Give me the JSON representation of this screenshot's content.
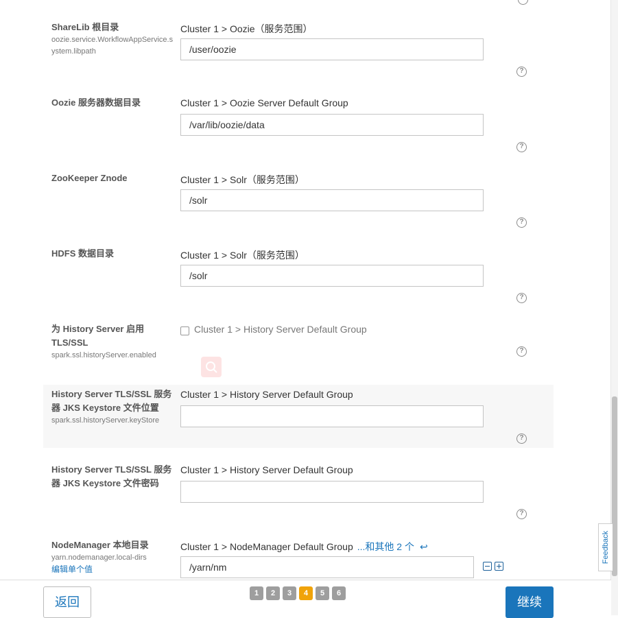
{
  "rows": [
    {
      "title": "ShareLib 根目录",
      "key": "oozie.service.WorkflowAppService.system.libpath",
      "scope": "Cluster 1 > Oozie（服务范围）",
      "value": "/user/oozie"
    },
    {
      "title": "Oozie 服务器数据目录",
      "scope": "Cluster 1 > Oozie Server Default Group",
      "value": "/var/lib/oozie/data"
    },
    {
      "title": "ZooKeeper Znode",
      "scope": "Cluster 1 > Solr（服务范围）",
      "value": "/solr"
    },
    {
      "title": "HDFS 数据目录",
      "scope": "Cluster 1 > Solr（服务范围）",
      "value": "/solr"
    },
    {
      "title": "为 History Server 启用 TLS/SSL",
      "key": "spark.ssl.historyServer.enabled",
      "scope": "Cluster 1 > History Server Default Group",
      "checked": false
    },
    {
      "title": "History Server TLS/SSL 服务器 JKS Keystore 文件位置",
      "key": "spark.ssl.historyServer.keyStore",
      "scope": "Cluster 1 > History Server Default Group",
      "value": ""
    },
    {
      "title": "History Server TLS/SSL 服务器 JKS Keystore 文件密码",
      "scope": "Cluster 1 > History Server Default Group",
      "value": ""
    },
    {
      "title": "NodeManager 本地目录",
      "key": "yarn.nodemanager.local-dirs",
      "link": "编辑单个值",
      "scope": "Cluster 1 > NodeManager Default Group",
      "scope_extra": "...和其他 2 个",
      "value": "/yarn/nm"
    }
  ],
  "help_glyph": "?",
  "feedback_label": "Feedback",
  "footer": {
    "back_label": "返回",
    "continue_label": "继续",
    "pages": [
      "1",
      "2",
      "3",
      "4",
      "5",
      "6"
    ],
    "active_page": "4"
  },
  "colors": {
    "accent": "#1a75bb",
    "active_page": "#f0a30a",
    "inactive_page": "#9e9e9e"
  }
}
